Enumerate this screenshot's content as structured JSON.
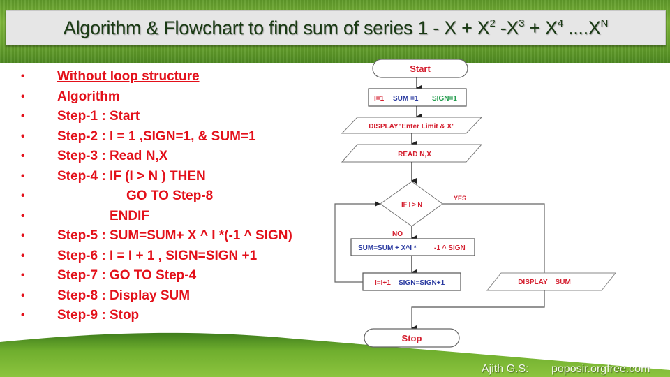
{
  "title": {
    "main": "Algorithm & Flowchart to find sum of series 1 - X + X",
    "exp2": "2",
    "mid1": " -X",
    "exp3": "3",
    "mid2": " + X",
    "exp4": "4",
    "mid3": " ....X",
    "expN": "N"
  },
  "algorithm": {
    "bullet": "•",
    "items": [
      "Without loop structure",
      "Algorithm",
      "Step-1 : Start",
      "Step-2 : I = 1 ,SIGN=1, & SUM=1",
      "Step-3 : Read N,X",
      "Step-4 : IF (I > N ) THEN",
      "GO TO Step-8",
      "ENDIF",
      "Step-5 : SUM=SUM+ X ^ I *(-1 ^ SIGN)",
      "Step-6 : I = I + 1 , SIGN=SIGN +1",
      "Step-7 : GO TO Step-4",
      "Step-8 : Display SUM",
      "Step-9 : Stop"
    ]
  },
  "flowchart": {
    "start": "Start",
    "init": {
      "i": "I=1",
      "sum": "SUM =1",
      "sign": "SIGN=1"
    },
    "display_prompt": "DISPLAY\"Enter Limit & X\"",
    "read": "READ N,X",
    "decision": "IF I > N",
    "yes": "YES",
    "no": "NO",
    "process_sum": {
      "part1": "SUM=SUM + X^I *",
      "part2": "-1 ^ SIGN"
    },
    "increment": {
      "i": "I=I+1",
      "sign": "SIGN=SIGN+1"
    },
    "display_sum": "DISPLAY    SUM",
    "stop": "Stop",
    "colors": {
      "red": "#d42030",
      "blue": "#2a3aa0",
      "green": "#1f9a4a",
      "line": "#555555"
    }
  },
  "footer": {
    "author": "Ajith G.S:",
    "site": "poposir.orgfree.com"
  }
}
